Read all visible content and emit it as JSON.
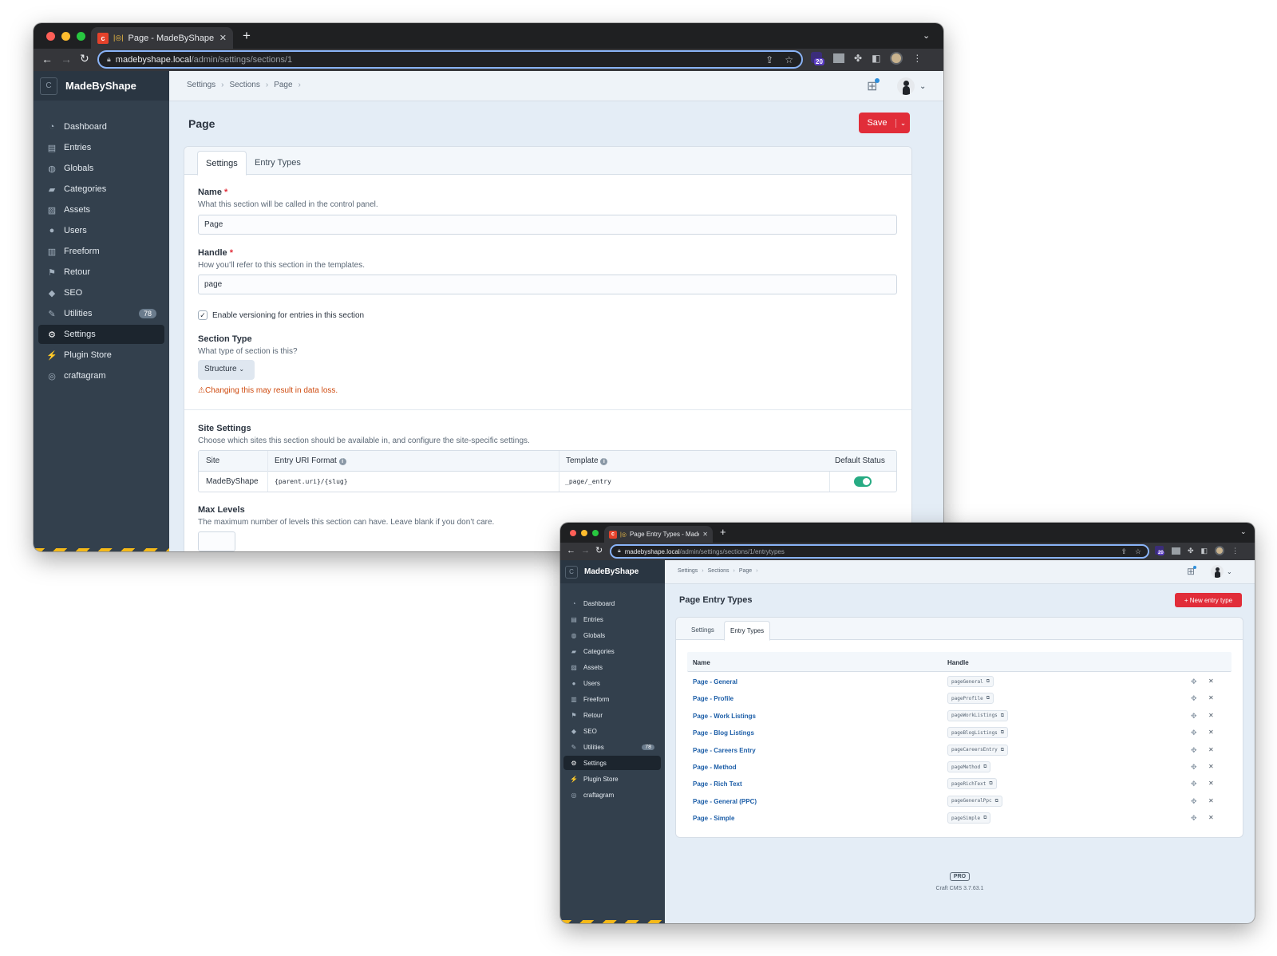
{
  "windows": {
    "settings": {
      "tab_title": "Page - MadeByShape",
      "url_host": "madebyshape.local",
      "url_path": "/admin/settings/sections/1",
      "ext_badge": "20"
    },
    "entry_types": {
      "tab_title": "Page Entry Types - Made",
      "url_host": "madebyshape.local",
      "url_path": "/admin/settings/sections/1/entrytypes",
      "ext_badge": "20"
    }
  },
  "cms": {
    "brand": {
      "logo": "C",
      "name": "MadeByShape"
    },
    "nav": [
      {
        "label": "Dashboard",
        "icon": "dashboard-icon"
      },
      {
        "label": "Entries",
        "icon": "entries-icon"
      },
      {
        "label": "Globals",
        "icon": "globe-icon"
      },
      {
        "label": "Categories",
        "icon": "folder-icon"
      },
      {
        "label": "Assets",
        "icon": "image-icon"
      },
      {
        "label": "Users",
        "icon": "users-icon"
      },
      {
        "label": "Freeform",
        "icon": "freeform-icon"
      },
      {
        "label": "Retour",
        "icon": "flag-icon"
      },
      {
        "label": "SEO",
        "icon": "tag-icon"
      },
      {
        "label": "Utilities",
        "icon": "wrench-icon",
        "badge": "78"
      },
      {
        "label": "Settings",
        "icon": "gear-icon",
        "active": true
      },
      {
        "label": "Plugin Store",
        "icon": "plug-icon"
      },
      {
        "label": "craftagram",
        "icon": "instagram-icon"
      }
    ],
    "breadcrumbs": [
      "Settings",
      "Sections",
      "Page"
    ]
  },
  "settings_page": {
    "title": "Page",
    "save_label": "Save",
    "tabs": [
      "Settings",
      "Entry Types"
    ],
    "name": {
      "label": "Name",
      "instructions": "What this section will be called in the control panel.",
      "value": "Page"
    },
    "handle": {
      "label": "Handle",
      "instructions": "How you’ll refer to this section in the templates.",
      "value": "page"
    },
    "versioning_label": "Enable versioning for entries in this section",
    "section_type": {
      "label": "Section Type",
      "instructions": "What type of section is this?",
      "value": "Structure",
      "warning": "Changing this may result in data loss."
    },
    "site_settings": {
      "label": "Site Settings",
      "instructions": "Choose which sites this section should be available in, and configure the site-specific settings.",
      "columns": [
        "Site",
        "Entry URI Format",
        "Template",
        "Default Status"
      ],
      "row": {
        "site": "MadeByShape",
        "uri_format": "{parent.uri}/{slug}",
        "template": "_page/_entry",
        "default_status_on": true
      }
    },
    "max_levels": {
      "label": "Max Levels",
      "instructions": "The maximum number of levels this section can have. Leave blank if you don’t care."
    }
  },
  "entry_types_page": {
    "title": "Page Entry Types",
    "new_button": "+ New entry type",
    "tabs": [
      "Settings",
      "Entry Types"
    ],
    "columns": [
      "Name",
      "Handle"
    ],
    "rows": [
      {
        "name": "Page - General",
        "handle": "pageGeneral"
      },
      {
        "name": "Page - Profile",
        "handle": "pageProfile"
      },
      {
        "name": "Page - Work Listings",
        "handle": "pageWorkListings"
      },
      {
        "name": "Page - Blog Listings",
        "handle": "pageBlogListings"
      },
      {
        "name": "Page - Careers Entry",
        "handle": "pageCareersEntry"
      },
      {
        "name": "Page - Method",
        "handle": "pageMethod"
      },
      {
        "name": "Page - Rich Text",
        "handle": "pageRichText"
      },
      {
        "name": "Page - General (PPC)",
        "handle": "pageGeneralPpc"
      },
      {
        "name": "Page - Simple",
        "handle": "pageSimple"
      }
    ],
    "edition": "PRO",
    "version": "Craft CMS 3.7.63.1"
  },
  "colors": {
    "accent_red": "#e12d39",
    "sidebar": "#33404d",
    "toggle_on": "#27ab83",
    "link_blue": "#1e5fa8"
  }
}
